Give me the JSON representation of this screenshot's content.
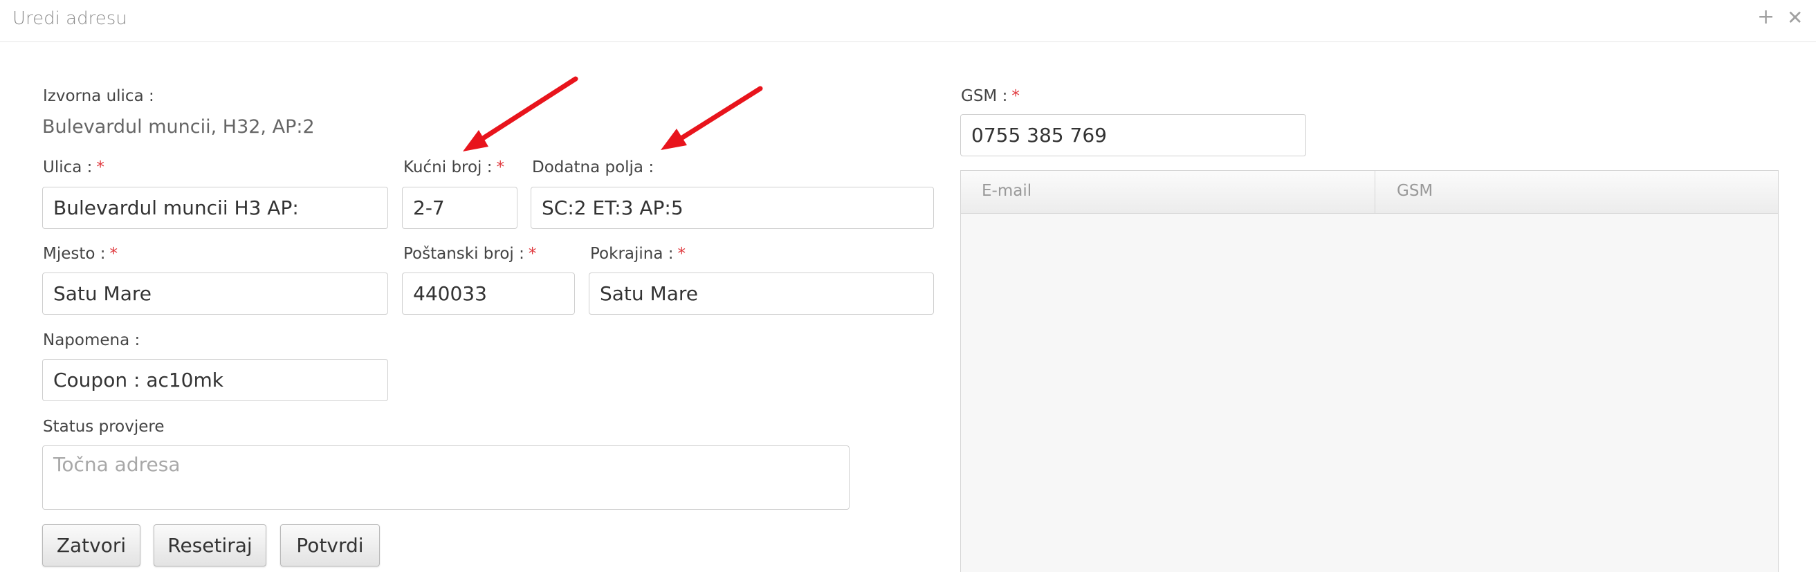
{
  "window": {
    "title": "Uredi adresu",
    "add_icon": "plus-icon",
    "close_icon": "close-icon"
  },
  "form": {
    "source_street_label": "Izvorna ulica :",
    "source_street_value": "Bulevardul muncii, H32, AP:2",
    "street": {
      "label": "Ulica :",
      "required": "*",
      "value": "Bulevardul muncii H3 AP:"
    },
    "house_number": {
      "label": "Kućni broj :",
      "required": "*",
      "value": "2-7"
    },
    "extra_fields": {
      "label": "Dodatna polja :",
      "value": "SC:2 ET:3 AP:5"
    },
    "city": {
      "label": "Mjesto :",
      "required": "*",
      "value": "Satu Mare"
    },
    "postal_code": {
      "label": "Poštanski broj :",
      "required": "*",
      "value": "440033"
    },
    "province": {
      "label": "Pokrajina :",
      "required": "*",
      "value": "Satu Mare"
    },
    "note": {
      "label": "Napomena :",
      "value": "Coupon : ac10mk"
    },
    "verification": {
      "label": "Status provjere",
      "placeholder": "Točna adresa"
    }
  },
  "buttons": {
    "close": "Zatvori",
    "reset": "Resetiraj",
    "confirm": "Potvrdi"
  },
  "contact": {
    "gsm": {
      "label": "GSM :",
      "required": "*",
      "value": "0755 385 769"
    },
    "table": {
      "columns": [
        "E-mail",
        "GSM"
      ],
      "rows": []
    }
  },
  "annotations": {
    "arrow_color": "#e8141c"
  }
}
